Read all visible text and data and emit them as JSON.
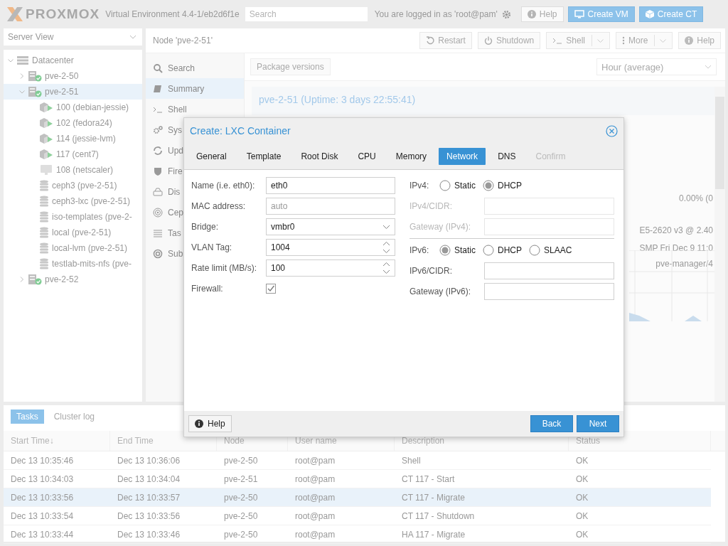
{
  "topbar": {
    "logo": "PROXMOX",
    "version": "Virtual Environment 4.4-1/eb2d6f1e",
    "search": {
      "placeholder": "Search"
    },
    "login": "You are logged in as 'root@pam'",
    "buttons": [
      {
        "label": "Help",
        "kind": "help"
      },
      {
        "label": "Create VM",
        "kind": "vm"
      },
      {
        "label": "Create CT",
        "kind": "ct"
      }
    ]
  },
  "sidebar": {
    "view": "Server View",
    "tree": [
      {
        "label": "Datacenter",
        "kind": "datacenter",
        "expanded": true,
        "selected": false,
        "children": [
          {
            "label": "pve-2-50",
            "kind": "node",
            "expanded": false,
            "selected": false
          },
          {
            "label": "pve-2-51",
            "kind": "node",
            "expanded": true,
            "selected": true,
            "children": [
              {
                "label": "100 (debian-jessie)",
                "kind": "ct-running",
                "selected": false
              },
              {
                "label": "102 (fedora24)",
                "kind": "ct-running",
                "selected": false
              },
              {
                "label": "114 (jessie-lvm)",
                "kind": "ct-running",
                "selected": false
              },
              {
                "label": "117 (cent7)",
                "kind": "ct-running",
                "selected": false
              },
              {
                "label": "108 (netscaler)",
                "kind": "vm-stopped",
                "selected": false
              },
              {
                "label": "ceph3 (pve-2-51)",
                "kind": "storage",
                "selected": false
              },
              {
                "label": "ceph3-lxc (pve-2-51)",
                "kind": "storage",
                "selected": false
              },
              {
                "label": "iso-templates (pve-2-",
                "kind": "storage",
                "selected": false
              },
              {
                "label": "local (pve-2-51)",
                "kind": "storage",
                "selected": false
              },
              {
                "label": "local-lvm (pve-2-51)",
                "kind": "storage",
                "selected": false
              },
              {
                "label": "testlab-mits-nfs (pve-",
                "kind": "storage",
                "selected": false
              }
            ]
          },
          {
            "label": "pve-2-52",
            "kind": "node",
            "expanded": false,
            "selected": false
          }
        ]
      }
    ]
  },
  "node_panel": {
    "title": "Node 'pve-2-51'",
    "buttons": [
      {
        "label": "Restart",
        "kind": "restart"
      },
      {
        "label": "Shutdown",
        "kind": "shutdown"
      },
      {
        "label": "Shell",
        "kind": "shell"
      },
      {
        "label": "More",
        "kind": "more"
      },
      {
        "label": "Help",
        "kind": "help"
      }
    ],
    "nav": [
      {
        "label": "Search",
        "kind": "search",
        "selected": false
      },
      {
        "label": "Summary",
        "kind": "summary",
        "selected": true
      },
      {
        "label": "Shell",
        "kind": "shell",
        "selected": false
      },
      {
        "label": "Sys",
        "kind": "system",
        "selected": false
      },
      {
        "label": "Upd",
        "kind": "updates",
        "selected": false
      },
      {
        "label": "Fire",
        "kind": "firewall",
        "selected": false
      },
      {
        "label": "Dis",
        "kind": "disks",
        "selected": false
      },
      {
        "label": "Cep",
        "kind": "ceph",
        "selected": false
      },
      {
        "label": "Tas",
        "kind": "tasks",
        "selected": false
      },
      {
        "label": "Sub",
        "kind": "subscription",
        "selected": false
      }
    ],
    "toolbar": {
      "button": "Package versions",
      "timeframe": "Hour (average)"
    },
    "summary_title": "pve-2-51 (Uptime: 3 days 22:55:41)",
    "summary_values": [
      "0.00% (0",
      "E5-2620 v3 @ 2.40",
      "SMP Fri Dec 9 11:0",
      "pve-manager/4"
    ]
  },
  "dialog": {
    "title": "Create: LXC Container",
    "tabs": [
      {
        "label": "General",
        "selected": false,
        "disabled": false
      },
      {
        "label": "Template",
        "selected": false,
        "disabled": false
      },
      {
        "label": "Root Disk",
        "selected": false,
        "disabled": false
      },
      {
        "label": "CPU",
        "selected": false,
        "disabled": false
      },
      {
        "label": "Memory",
        "selected": false,
        "disabled": false
      },
      {
        "label": "Network",
        "selected": true,
        "disabled": false
      },
      {
        "label": "DNS",
        "selected": false,
        "disabled": false
      },
      {
        "label": "Confirm",
        "selected": false,
        "disabled": true
      }
    ],
    "left_fields": [
      {
        "label": "Name (i.e. eth0):",
        "kind": "text",
        "value": "eth0"
      },
      {
        "label": "MAC address:",
        "kind": "text",
        "placeholder": "auto"
      },
      {
        "label": "Bridge:",
        "kind": "select",
        "value": "vmbr0"
      },
      {
        "label": "VLAN Tag:",
        "kind": "number",
        "value": "1004"
      },
      {
        "label": "Rate limit (MB/s):",
        "kind": "number",
        "value": "100"
      },
      {
        "label": "Firewall:",
        "kind": "checkbox",
        "checked": true
      }
    ],
    "ip_groups": [
      {
        "label": "IPv4:",
        "options": [
          {
            "label": "Static",
            "selected": false
          },
          {
            "label": "DHCP",
            "selected": true
          }
        ],
        "fields": [
          {
            "label": "IPv4/CIDR:",
            "disabled": true
          },
          {
            "label": "Gateway (IPv4):",
            "disabled": true
          }
        ]
      },
      {
        "label": "IPv6:",
        "options": [
          {
            "label": "Static",
            "selected": true
          },
          {
            "label": "DHCP",
            "selected": false
          },
          {
            "label": "SLAAC",
            "selected": false
          }
        ],
        "fields": [
          {
            "label": "IPv6/CIDR:",
            "disabled": false
          },
          {
            "label": "Gateway (IPv6):",
            "disabled": false
          }
        ]
      }
    ],
    "help": "Help",
    "buttons": [
      "Back",
      "Next"
    ]
  },
  "tasks": {
    "tabs": [
      {
        "label": "Tasks",
        "selected": true
      },
      {
        "label": "Cluster log",
        "selected": false
      }
    ],
    "columns": [
      {
        "label": "Start Time",
        "sort_arrow": "↓"
      },
      {
        "label": "End Time"
      },
      {
        "label": "Node"
      },
      {
        "label": "User name"
      },
      {
        "label": "Description"
      },
      {
        "label": "Status"
      }
    ],
    "rows": [
      {
        "cells": [
          "Dec 13 10:35:46",
          "Dec 13 10:36:06",
          "pve-2-50",
          "root@pam",
          "Shell",
          "OK"
        ],
        "selected": false
      },
      {
        "cells": [
          "Dec 13 10:34:03",
          "Dec 13 10:34:04",
          "pve-2-51",
          "root@pam",
          "CT 117 - Start",
          "OK"
        ],
        "selected": false
      },
      {
        "cells": [
          "Dec 13 10:33:56",
          "Dec 13 10:33:57",
          "pve-2-50",
          "root@pam",
          "CT 117 - Migrate",
          "OK"
        ],
        "selected": true
      },
      {
        "cells": [
          "Dec 13 10:33:54",
          "Dec 13 10:33:56",
          "pve-2-50",
          "root@pam",
          "CT 117 - Shutdown",
          "OK"
        ],
        "selected": false
      },
      {
        "cells": [
          "Dec 13 10:33:44",
          "Dec 13 10:33:46",
          "pve-2-50",
          "root@pam",
          "HA 117 - Migrate",
          "OK"
        ],
        "selected": false
      }
    ]
  }
}
